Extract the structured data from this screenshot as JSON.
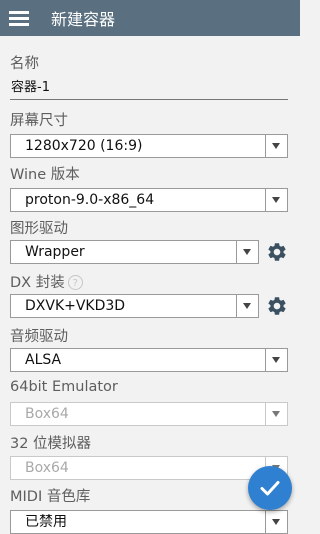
{
  "appbar": {
    "title": "新建容器",
    "menu_icon": "menu-icon"
  },
  "form": {
    "name": {
      "label": "名称",
      "value": "容器-1"
    },
    "screen_size": {
      "label": "屏幕尺寸",
      "value": "1280x720 (16:9)"
    },
    "wine_version": {
      "label": "Wine 版本",
      "value": "proton-9.0-x86_64"
    },
    "graphics_driver": {
      "label": "图形驱动",
      "value": "Wrapper",
      "settings_icon": "gear-icon"
    },
    "dx_wrapper": {
      "label": "DX 封装",
      "help": "?",
      "value": "DXVK+VKD3D",
      "settings_icon": "gear-icon"
    },
    "audio_driver": {
      "label": "音频驱动",
      "value": "ALSA"
    },
    "emulator_64bit": {
      "label": "64bit Emulator",
      "value": "Box64",
      "disabled": true
    },
    "emulator_32bit": {
      "label": "32 位模拟器",
      "value": "Box64",
      "disabled": true
    },
    "midi_soundfont": {
      "label": "MIDI 音色库",
      "value": "已禁用"
    }
  },
  "fab": {
    "icon": "check-icon"
  },
  "colors": {
    "appbar": "#5a7081",
    "background": "#f2f2f2",
    "fab": "#2f80d0",
    "gear": "#3b5060"
  }
}
